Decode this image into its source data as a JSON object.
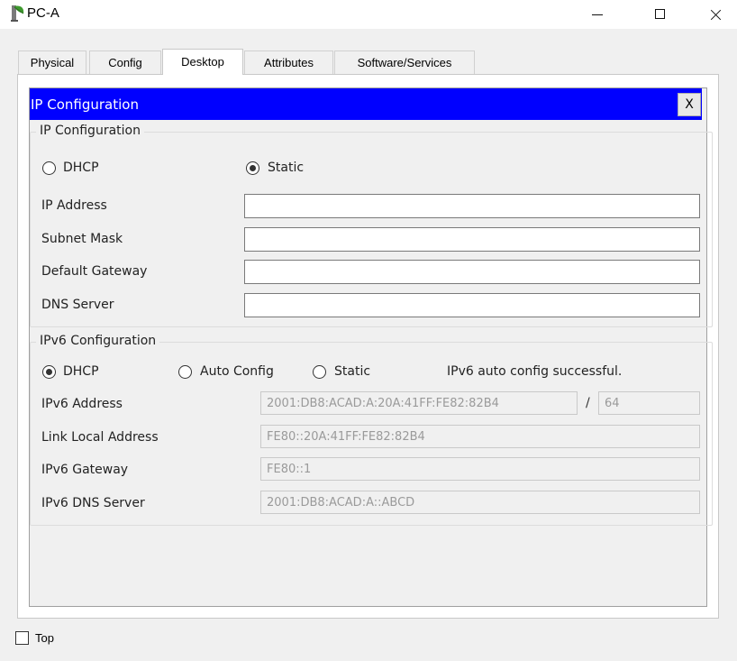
{
  "window": {
    "title": "PC-A",
    "icon": "pc-leaf-icon"
  },
  "tabs": [
    {
      "label": "Physical",
      "active": false
    },
    {
      "label": "Config",
      "active": false
    },
    {
      "label": "Desktop",
      "active": true
    },
    {
      "label": "Attributes",
      "active": false
    },
    {
      "label": "Software/Services",
      "active": false
    }
  ],
  "ipconfig": {
    "header_title": "IP Configuration",
    "close_label": "X",
    "header_color": "#0000ff",
    "ipv4": {
      "group_title": "IP Configuration",
      "dhcp_label": "DHCP",
      "static_label": "Static",
      "selected_mode": "Static",
      "ip_address_label": "IP Address",
      "ip_address_value": "",
      "subnet_mask_label": "Subnet Mask",
      "subnet_mask_value": "",
      "default_gateway_label": "Default Gateway",
      "default_gateway_value": "",
      "dns_server_label": "DNS Server",
      "dns_server_value": ""
    },
    "ipv6": {
      "group_title": "IPv6 Configuration",
      "dhcp_label": "DHCP",
      "auto_config_label": "Auto Config",
      "static_label": "Static",
      "selected_mode": "DHCP",
      "status_text": "IPv6 auto config successful.",
      "address_label": "IPv6 Address",
      "address_value": "2001:DB8:ACAD:A:20A:41FF:FE82:82B4",
      "prefix_separator": "/",
      "prefix_length": "64",
      "link_local_label": "Link Local Address",
      "link_local_value": "FE80::20A:41FF:FE82:82B4",
      "gateway_label": "IPv6 Gateway",
      "gateway_value": "FE80::1",
      "dns_label": "IPv6 DNS Server",
      "dns_value": "2001:DB8:ACAD:A::ABCD"
    }
  },
  "footer": {
    "top_label": "Top",
    "top_checked": false
  }
}
